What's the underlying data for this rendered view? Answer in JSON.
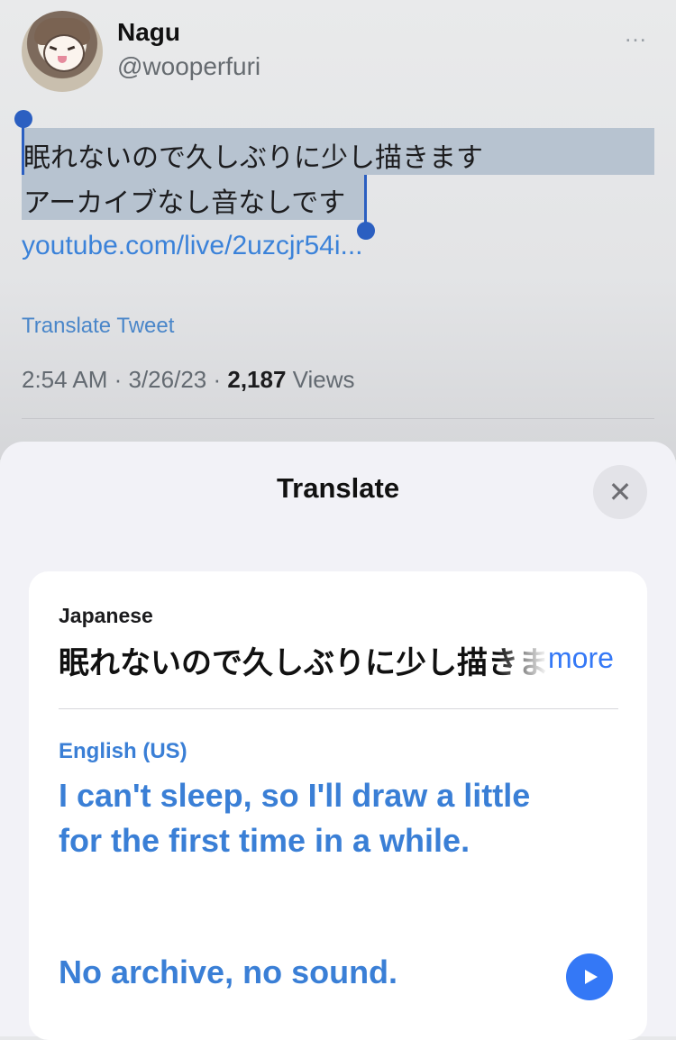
{
  "tweet": {
    "author_name": "Nagu",
    "handle": "@wooperfuri",
    "more_icon": "…",
    "text_line1": "眠れないので久しぶりに少し描きます",
    "text_line2": "アーカイブなし音なしです",
    "link": "youtube.com/live/2uzcjr54i...",
    "translate_label": "Translate Tweet",
    "timestamp": "2:54 AM · 3/26/23 · ",
    "views_count": "2,187",
    "views_label": " Views"
  },
  "sheet": {
    "title": "Translate",
    "close_icon": "✕",
    "source_language": "Japanese",
    "source_text": "眠れないので久しぶりに少し描きます",
    "more_label": "more",
    "target_language": "English (US)",
    "target_text_1": "I can't sleep, so I'll draw a little for the first time in a while.",
    "target_text_2": "No archive, no sound."
  },
  "colors": {
    "accent": "#3478f6",
    "selection": "#b7c3d0",
    "link": "#3b82d9"
  }
}
